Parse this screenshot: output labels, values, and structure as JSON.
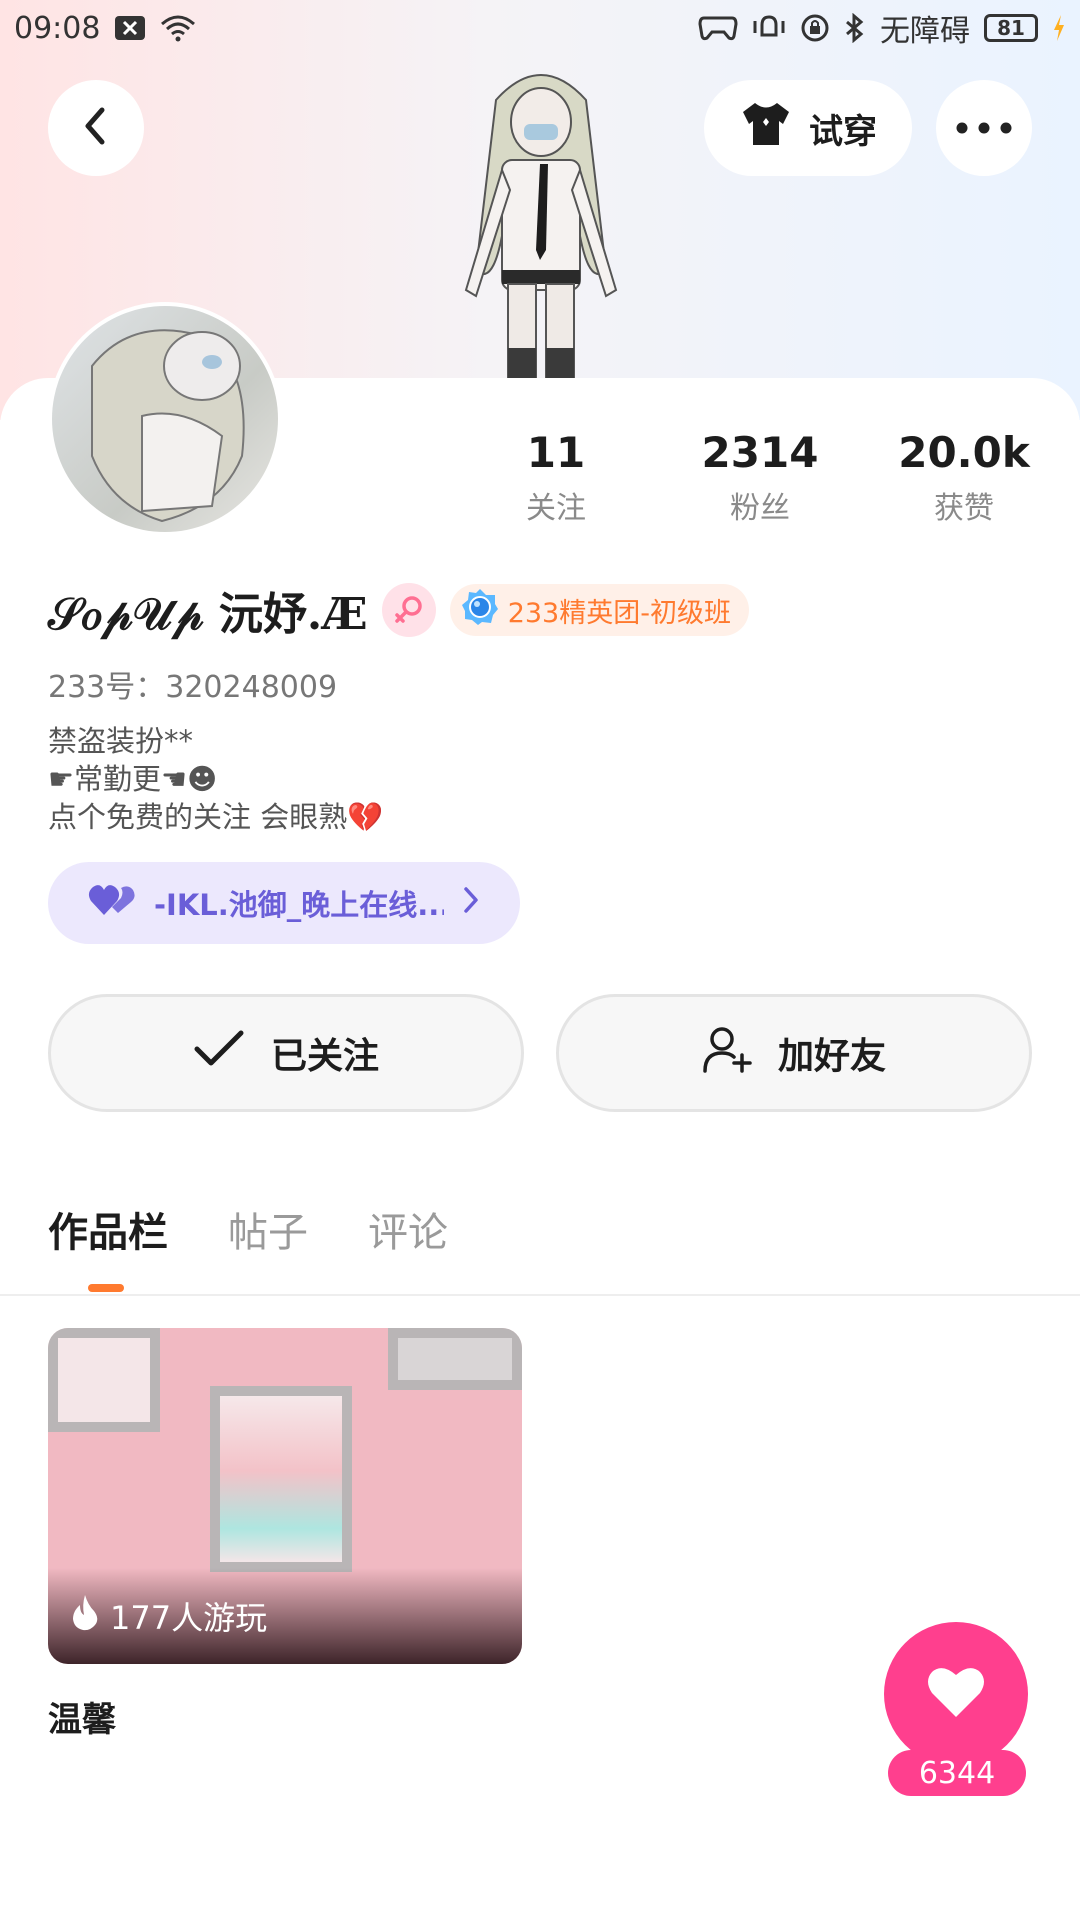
{
  "status_bar": {
    "time": "09:08",
    "accessibility_label": "无障碍",
    "battery": "81"
  },
  "header": {
    "tryon_label": "试穿"
  },
  "stats": [
    {
      "value": "11",
      "label": "关注"
    },
    {
      "value": "2314",
      "label": "粉丝"
    },
    {
      "value": "20.0k",
      "label": "获赞"
    }
  ],
  "profile": {
    "name": "𝒮𝑜𝓅𝒰𝓅 沅妤.Æ",
    "club_badge": "233精英团-初级班",
    "uid": "233号：320248009",
    "bio": [
      "禁盗装扮**",
      "☛常勤更☚☻",
      "点个免费的关注 会眼熟💔"
    ],
    "status_pill": "-IKL.池御_晚上在线..."
  },
  "actions": {
    "followed_label": "已关注",
    "add_friend_label": "加好友"
  },
  "tabs": [
    "作品栏",
    "帖子",
    "评论"
  ],
  "works": [
    {
      "plays": "177人游玩",
      "title": "温馨"
    }
  ],
  "like_fab": {
    "count": "6344"
  },
  "colors": {
    "accent_orange": "#ff7a2f",
    "like_pink": "#ff3f8e",
    "status_purple": "#6a5ed8"
  }
}
